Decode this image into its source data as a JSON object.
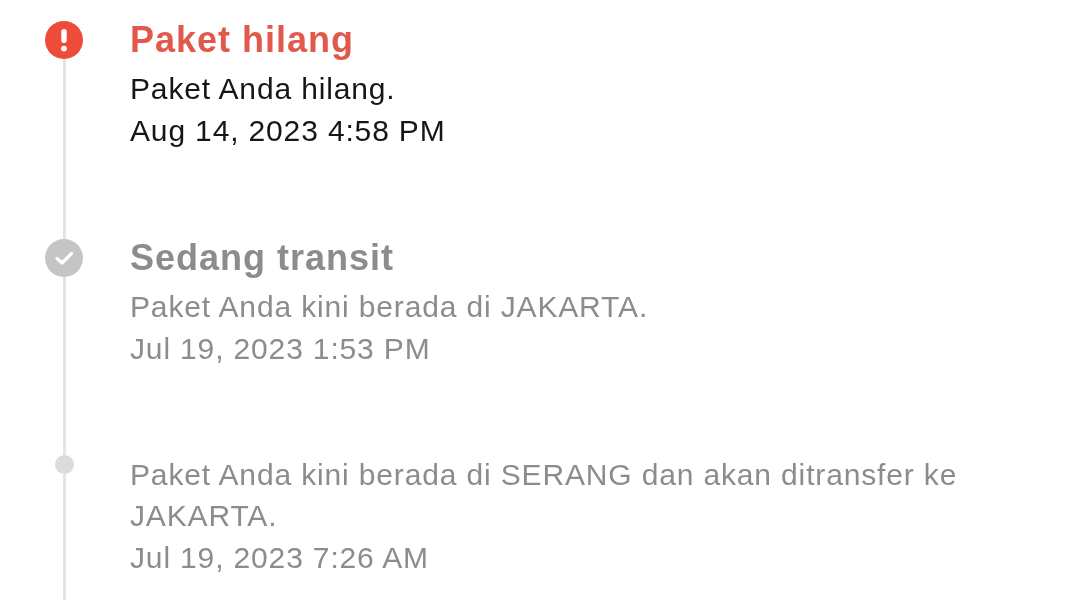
{
  "timeline": [
    {
      "kind": "alert",
      "current": true,
      "title": "Paket hilang",
      "description": "Paket Anda hilang.",
      "timestamp": "Aug 14, 2023 4:58 PM"
    },
    {
      "kind": "check",
      "current": false,
      "title": "Sedang transit",
      "description": "Paket Anda kini berada di JAKARTA.",
      "timestamp": "Jul 19, 2023 1:53 PM"
    },
    {
      "kind": "dot",
      "current": false,
      "description": "Paket Anda kini berada di SERANG dan akan ditransfer ke JAKARTA.",
      "timestamp": "Jul 19, 2023 7:26 AM"
    }
  ]
}
